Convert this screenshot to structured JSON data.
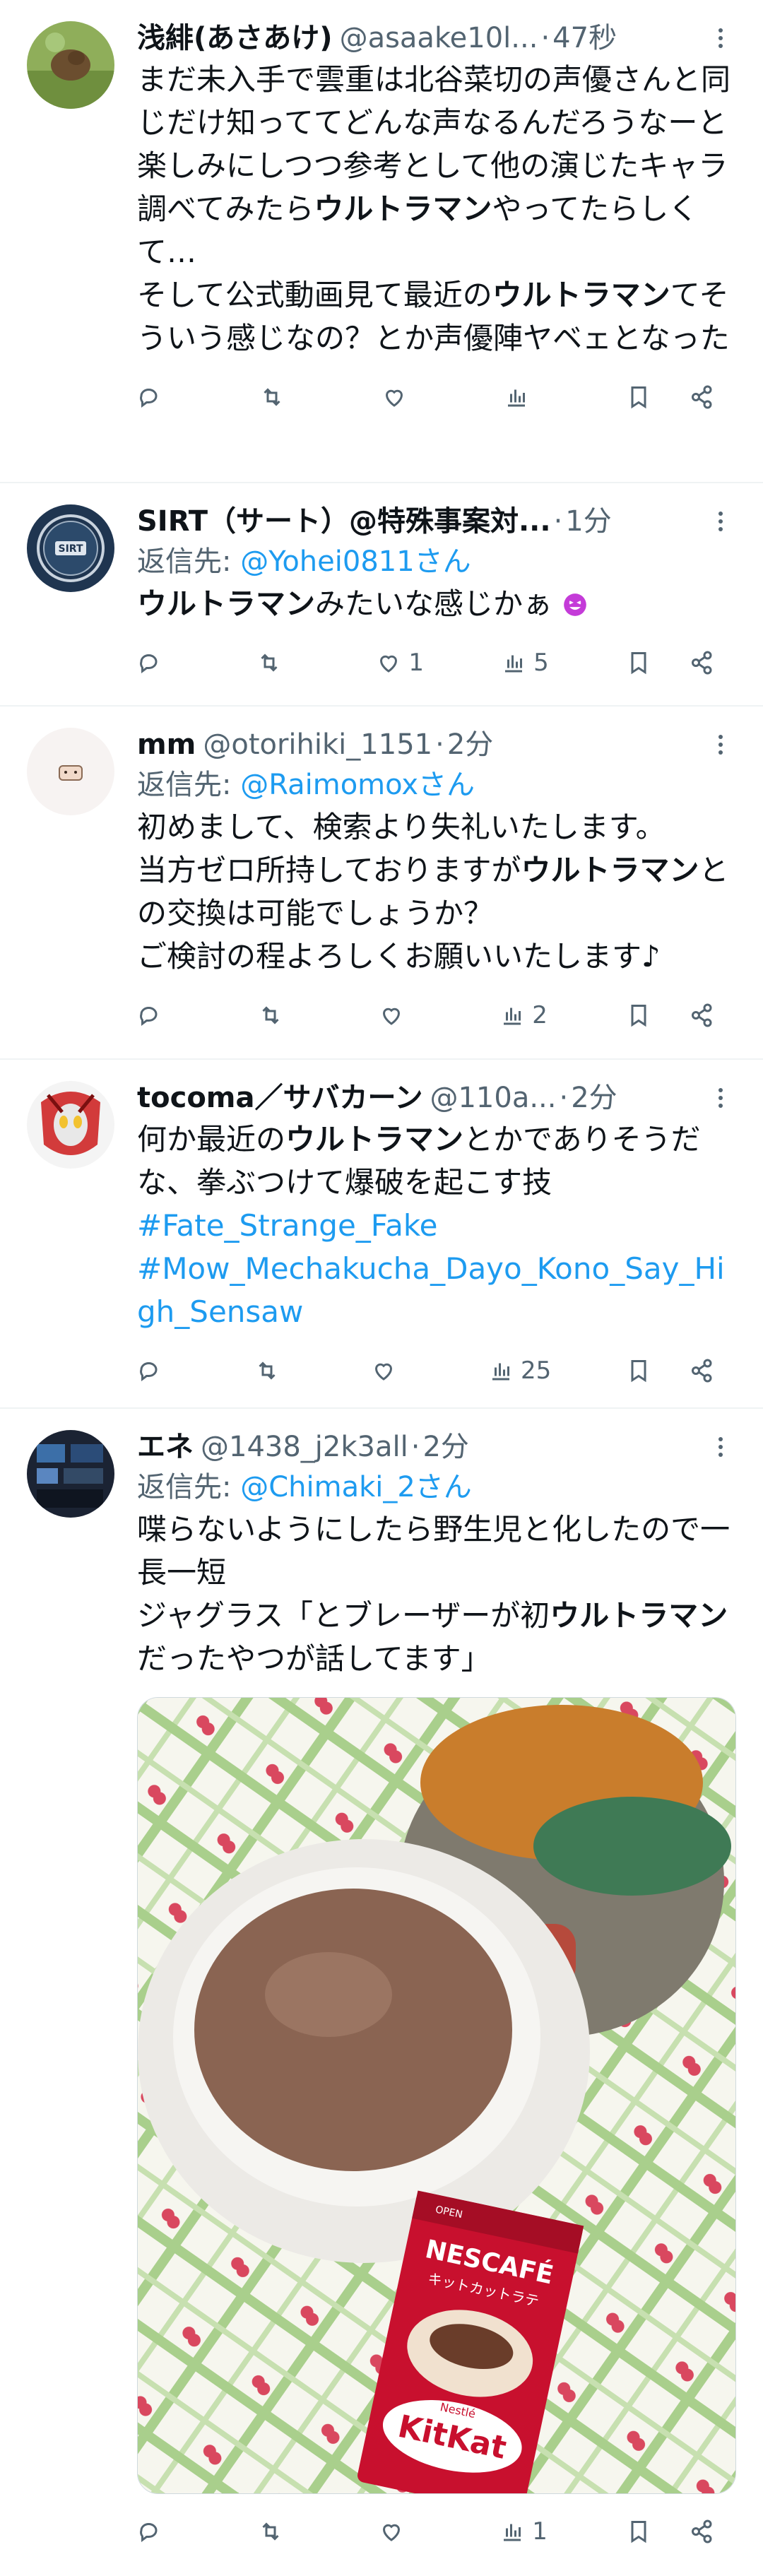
{
  "tweets": [
    {
      "name": "浅緋(あさあけ)",
      "handle": "@asaake10l...",
      "time": "47秒",
      "text_parts": [
        "まだ未入手で雲重は北谷菜切の声優さんと同じだけ知っててどんな声なるんだろうなーと楽しみにしつつ参考として他の演じたキャラ調べてみたら",
        "ウルトラマン",
        "やってたらしくて…\nそして公式動画見て最近の",
        "ウルトラマン",
        "てそういう感じなの？とか声優陣ヤベェとなった"
      ],
      "replies": "",
      "retweets": "",
      "likes": "",
      "views": ""
    },
    {
      "name": "SIRT（サート）@特殊事案対...",
      "time": "1分",
      "reply_label": "返信先: ",
      "reply_handle": "@Yohei0811さん",
      "text_parts": [
        "ウルトラマン",
        "みたいな感じかぁ"
      ],
      "replies": "",
      "retweets": "",
      "likes": "1",
      "views": "5"
    },
    {
      "name": "mm",
      "handle": "@otorihiki_1151",
      "time": "2分",
      "reply_label": "返信先: ",
      "reply_handle": "@Raimomoxさん",
      "text_parts": [
        "初めまして、検索より失礼いたします。\n当方ゼロ所持しておりますが",
        "ウルトラマン",
        "との交換は可能でしょうか？\nご検討の程よろしくお願いいたします♪"
      ],
      "replies": "",
      "retweets": "",
      "likes": "",
      "views": "2"
    },
    {
      "name": "tocoma／サバカーン",
      "handle": "@110a...",
      "time": "2分",
      "text_parts": [
        "何か最近の",
        "ウルトラマン",
        "とかでありそうだな、拳ぶつけて爆破を起こす技"
      ],
      "hashtags": [
        "#Fate_Strange_Fake",
        "#Mow_Mechakucha_Dayo_Kono_Say_High_Sensaw"
      ],
      "replies": "",
      "retweets": "",
      "likes": "",
      "views": "25"
    },
    {
      "name": "エネ",
      "handle": "@1438_j2k3all",
      "time": "2分",
      "reply_label": "返信先: ",
      "reply_handle": "@Chimaki_2さん",
      "text_parts": [
        "喋らないようにしたら野生児と化したので一長一短\nジャグラス「とブレーザーが初",
        "ウルトラマン",
        "だったやつが話してます」"
      ],
      "photo_texts": {
        "brand": "NESCAFÉ",
        "sub": "キットカットラテ",
        "kitkat": "KitKat",
        "nestle": "Nestlé",
        "open": "OPEN"
      },
      "replies": "",
      "retweets": "",
      "likes": "",
      "views": "1"
    }
  ],
  "colors": {
    "link": "#1d9bf0",
    "secondary": "#536471",
    "divider": "#eff3f4"
  },
  "icons": [
    "reply-icon",
    "retweet-icon",
    "like-icon",
    "views-icon",
    "bookmark-icon",
    "share-icon",
    "more-icon",
    "emoji-smile-icon"
  ]
}
